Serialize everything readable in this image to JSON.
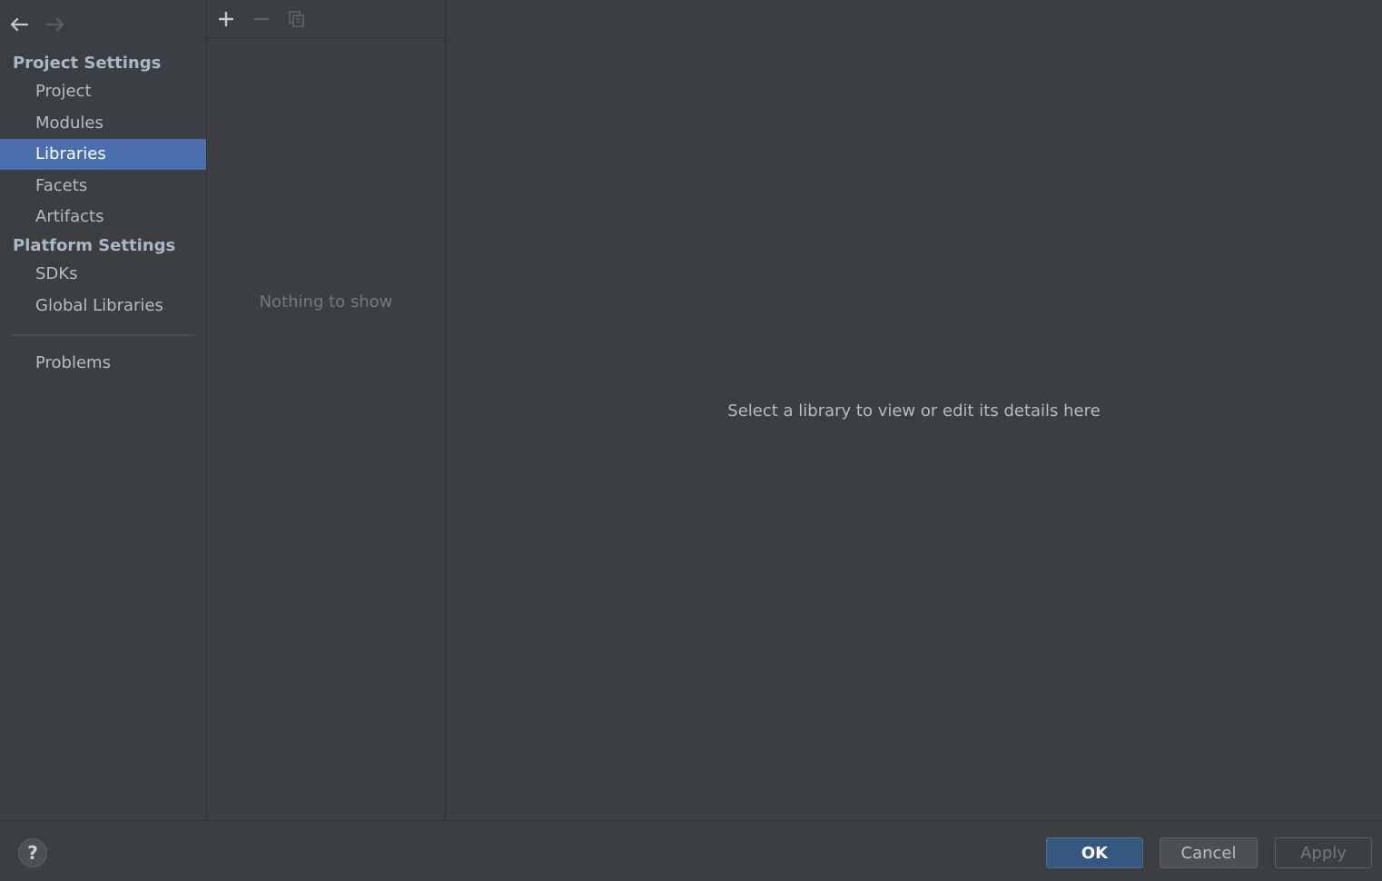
{
  "sidebar": {
    "project_settings_header": "Project Settings",
    "project_items": [
      {
        "label": "Project"
      },
      {
        "label": "Modules"
      },
      {
        "label": "Libraries"
      },
      {
        "label": "Facets"
      },
      {
        "label": "Artifacts"
      }
    ],
    "platform_settings_header": "Platform Settings",
    "platform_items": [
      {
        "label": "SDKs"
      },
      {
        "label": "Global Libraries"
      }
    ],
    "problems_label": "Problems",
    "selected": "Libraries"
  },
  "list_panel": {
    "toolbar_icons": [
      "add-icon",
      "remove-icon",
      "copy-icon"
    ],
    "empty_text": "Nothing to show"
  },
  "details_panel": {
    "hint": "Select a library to view or edit its details here"
  },
  "bottom_bar": {
    "help_label": "?",
    "ok_label": "OK",
    "cancel_label": "Cancel",
    "apply_label": "Apply"
  },
  "colors": {
    "background": "#3c3f41",
    "selection": "#4b6eaf",
    "ok_button": "#365880"
  }
}
